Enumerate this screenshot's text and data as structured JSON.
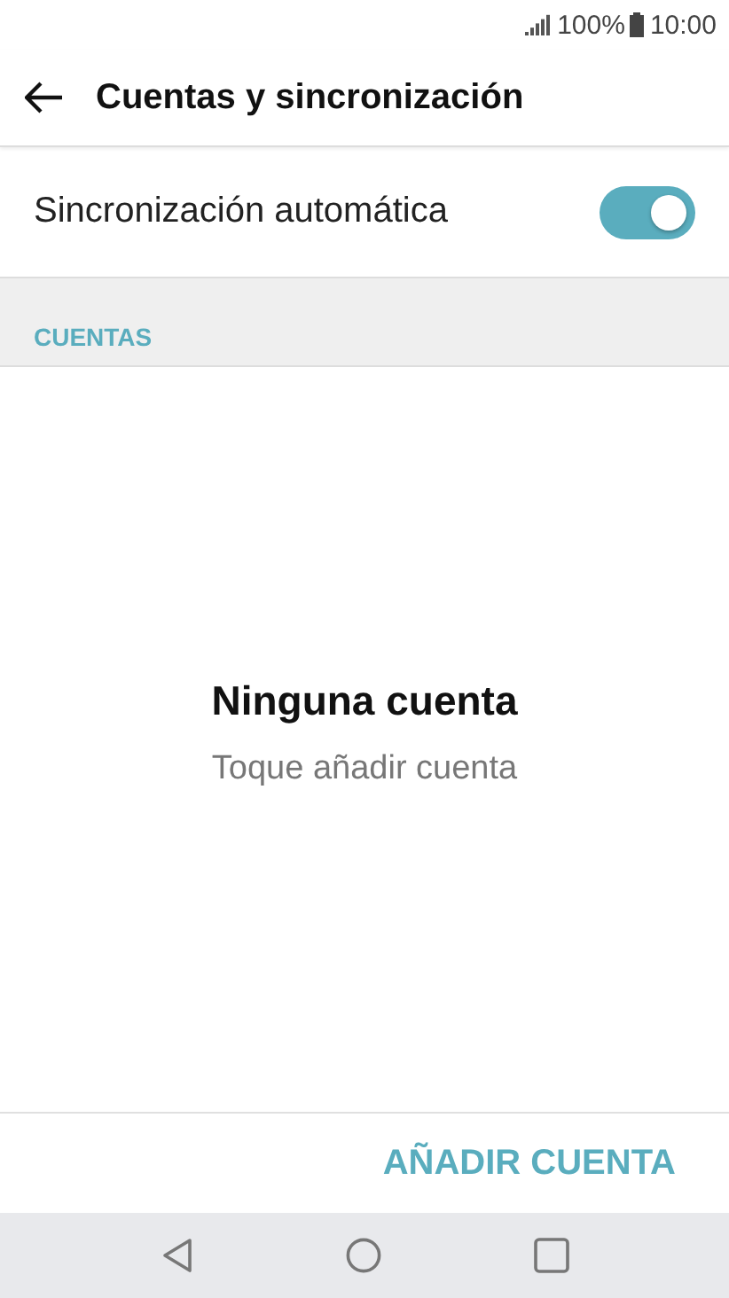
{
  "status_bar": {
    "battery": "100%",
    "time": "10:00"
  },
  "app_bar": {
    "title": "Cuentas y sincronización"
  },
  "auto_sync": {
    "label": "Sincronización automática",
    "on": true
  },
  "section": {
    "title": "CUENTAS"
  },
  "empty_state": {
    "title": "Ninguna cuenta",
    "hint": "Toque añadir cuenta"
  },
  "action": {
    "label": "AÑADIR CUENTA"
  }
}
